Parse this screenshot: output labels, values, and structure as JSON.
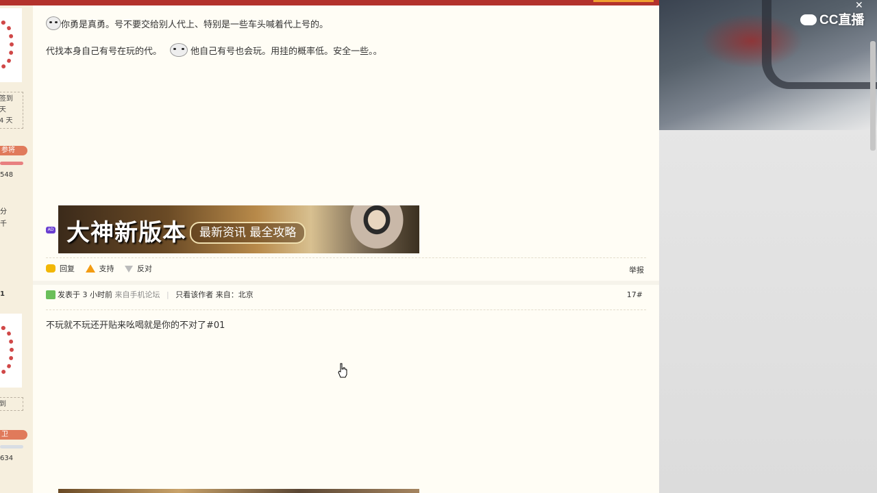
{
  "sidebar": {
    "sign_lines": [
      "签到",
      "天",
      "4 天"
    ],
    "rank1": "参将",
    "stat1": "548",
    "stat2": "分",
    "stat3": "千",
    "marker": "1",
    "sign2": "到",
    "rank2": "卫",
    "stat4": "634"
  },
  "post1": {
    "line1": "你勇是真勇。号不要交给别人代上、特别是一些车头喊着代上号的。",
    "line2a": "代找本身自己有号在玩的代。",
    "line2b": "他自己有号也会玩。用挂的概率低。安全一些。。"
  },
  "ad": {
    "tag": "AD",
    "title": "大神新版本",
    "subtitle": "最新资讯  最全攻略"
  },
  "actions": {
    "reply": "回复",
    "support": "支持",
    "oppose": "反对",
    "report": "举报"
  },
  "post2": {
    "meta_posted": "发表于 3 小时前",
    "meta_source": "来自手机论坛",
    "meta_author_only": "只看该作者",
    "meta_from": "来自：北京",
    "floor": "17#",
    "content": "不玩就不玩还开贴来吆喝就是你的不对了#01"
  },
  "overlay": {
    "brand": "CC直播"
  },
  "colors": {
    "topbar": "#b3322c",
    "main_bg": "#fffdf5",
    "sidebar_bg": "#f6efde"
  }
}
